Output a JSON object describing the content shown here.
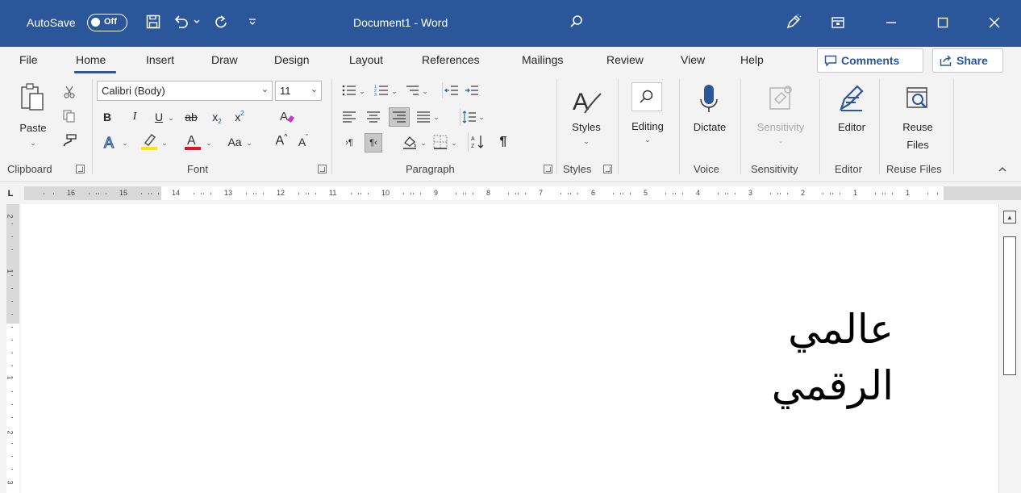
{
  "titlebar": {
    "autosave_label": "AutoSave",
    "autosave_state": "Off",
    "document_title": "Document1 - Word",
    "accent_color": "#2b579a",
    "icons": [
      "save-icon",
      "undo-icon",
      "redo-icon",
      "customize-qat-icon",
      "search-icon",
      "coauthor-icon",
      "ribbon-display-icon",
      "minimize-icon",
      "maximize-icon",
      "close-icon"
    ]
  },
  "tabs": {
    "items": [
      "File",
      "Home",
      "Insert",
      "Draw",
      "Design",
      "Layout",
      "References",
      "Mailings",
      "Review",
      "View",
      "Help"
    ],
    "active": "Home",
    "comments_label": "Comments",
    "share_label": "Share"
  },
  "ribbon": {
    "clipboard": {
      "paste_label": "Paste",
      "group_label": "Clipboard"
    },
    "font": {
      "font_name": "Calibri (Body)",
      "font_size": "11",
      "bold": "B",
      "italic": "I",
      "underline": "U",
      "strikethrough": "ab",
      "subscript": "x",
      "superscript": "x",
      "change_case": "Aa",
      "grow": "A",
      "shrink": "A",
      "group_label": "Font"
    },
    "paragraph": {
      "group_label": "Paragraph"
    },
    "styles": {
      "label": "Styles",
      "group_label": "Styles"
    },
    "editing": {
      "label": "Editing"
    },
    "voice": {
      "label": "Dictate",
      "group_label": "Voice"
    },
    "sensitivity": {
      "label": "Sensitivity",
      "group_label": "Sensitivity"
    },
    "editor": {
      "label": "Editor",
      "group_label": "Editor"
    },
    "reuse": {
      "label_line1": "Reuse",
      "label_line2": "Files",
      "group_label": "Reuse Files"
    }
  },
  "ruler": {
    "numbers": [
      "16",
      "15",
      "14",
      "13",
      "12",
      "11",
      "10",
      "9",
      "8",
      "7",
      "6",
      "5",
      "4",
      "3",
      "2",
      "1",
      "1"
    ],
    "vertical_numbers": [
      "2",
      "1",
      "1",
      "2",
      "3"
    ]
  },
  "document": {
    "lines": [
      "عالمي",
      "الرقمي"
    ]
  }
}
